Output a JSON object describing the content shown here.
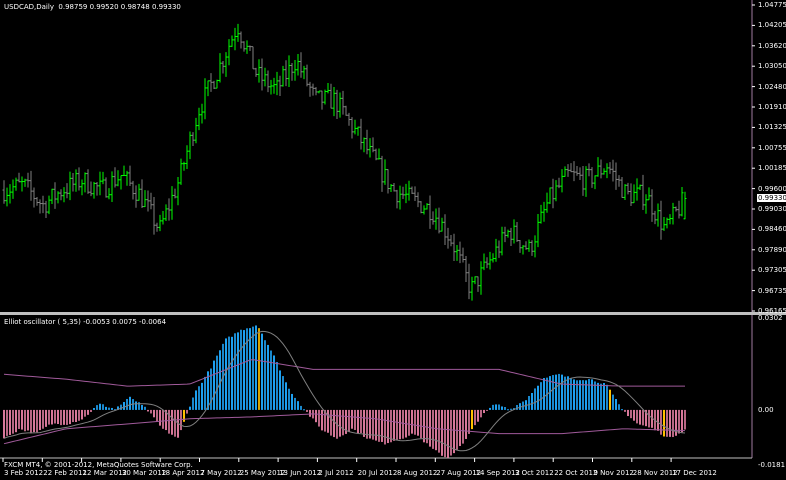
{
  "main": {
    "symbol_label": "USDCAD,Daily",
    "ohlc_label": "0.98759 0.99520 0.98748 0.99330",
    "current_price": "0.99330"
  },
  "oscillator": {
    "label": "Elliot oscillator ( 5,35)",
    "values_label": "-0.0053 0.0075 -0.0064"
  },
  "footer": {
    "copyright": "FXCM MT4, © 2001-2012, MetaQuotes Software Corp."
  },
  "colors": {
    "background": "#000000",
    "up_bar": "#00ff00",
    "down_bar": "#808080",
    "osc_positive": "#1ea0f0",
    "osc_negative": "#d8789a",
    "osc_highlight": "#ffc000",
    "envelope": "#a05a9a",
    "signal": "#808080",
    "axis": "#a07aa0"
  },
  "chart_data": [
    {
      "type": "ohlc",
      "title": "USDCAD,Daily",
      "ylim": [
        0.96165,
        1.04775
      ],
      "y_ticks": [
        "1.04775",
        "1.04205",
        "1.03620",
        "1.03050",
        "1.02480",
        "1.01910",
        "1.01325",
        "1.00755",
        "1.00185",
        "0.99600",
        "0.99030",
        "0.98460",
        "0.97890",
        "0.97305",
        "0.96735",
        "0.96165"
      ],
      "x_ticks": [
        "3 Feb 2012",
        "22 Feb 2012",
        "12 Mar 2012",
        "30 Mar 2012",
        "18 Apr 2012",
        "7 May 2012",
        "25 May 2012",
        "13 Jun 2012",
        "2 Jul 2012",
        "20 Jul 2012",
        "8 Aug 2012",
        "27 Aug 2012",
        "14 Sep 2012",
        "3 Oct 2012",
        "22 Oct 2012",
        "9 Nov 2012",
        "28 Nov 2012",
        "17 Dec 2012"
      ],
      "close_path": [
        0.99569,
        0.9971,
        0.99147,
        0.99569,
        0.99851,
        0.99569,
        0.99991,
        0.99428,
        0.98444,
        0.99851,
        1.0182,
        1.02946,
        1.04212,
        1.02805,
        1.02383,
        1.03227,
        1.02102,
        1.02102,
        1.01258,
        1.00413,
        0.99569,
        0.99288,
        0.99006,
        0.98162,
        0.96755,
        0.97599,
        0.98444,
        0.97881,
        0.99288,
        0.99991,
        0.99851,
        1.00273,
        0.99428,
        0.99428,
        0.98444,
        0.9933
      ],
      "last": {
        "open": 0.98759,
        "high": 0.9952,
        "low": 0.98748,
        "close": 0.9933
      }
    },
    {
      "type": "bar",
      "title": "Elliot oscillator ( 5,35)",
      "ylim": [
        -0.0181,
        0.0302
      ],
      "y_ticks": [
        "0.0302",
        "0.00",
        "-0.0181"
      ],
      "histogram_path": [
        -0.0094,
        -0.0062,
        -0.0078,
        -0.0046,
        -0.0046,
        -0.0029,
        0.002,
        0.0003,
        0.0042,
        0.0003,
        -0.0062,
        -0.0094,
        0.0052,
        0.0133,
        0.0231,
        0.0263,
        0.028,
        0.0182,
        0.0068,
        0.0,
        -0.0062,
        -0.0094,
        -0.0062,
        -0.0094,
        -0.0111,
        -0.0094,
        -0.0078,
        -0.0127,
        -0.0159,
        -0.0111,
        -0.0029,
        0.002,
        0.0003,
        0.0036,
        0.0101,
        0.0117,
        0.0101,
        0.0101,
        0.0085,
        0.0003,
        -0.0046,
        -0.0062,
        -0.0094,
        -0.0064
      ],
      "upper_band": [
        0.0117,
        0.0101,
        0.0078,
        0.0085,
        0.0166,
        0.0133,
        0.0133,
        0.0133,
        0.0133,
        0.0085,
        0.0078,
        0.0078
      ],
      "lower_band": [
        -0.0111,
        -0.0062,
        -0.0046,
        -0.0029,
        -0.0023,
        -0.0013,
        -0.0029,
        -0.0062,
        -0.0078,
        -0.0078,
        -0.0062,
        -0.0068
      ]
    }
  ]
}
